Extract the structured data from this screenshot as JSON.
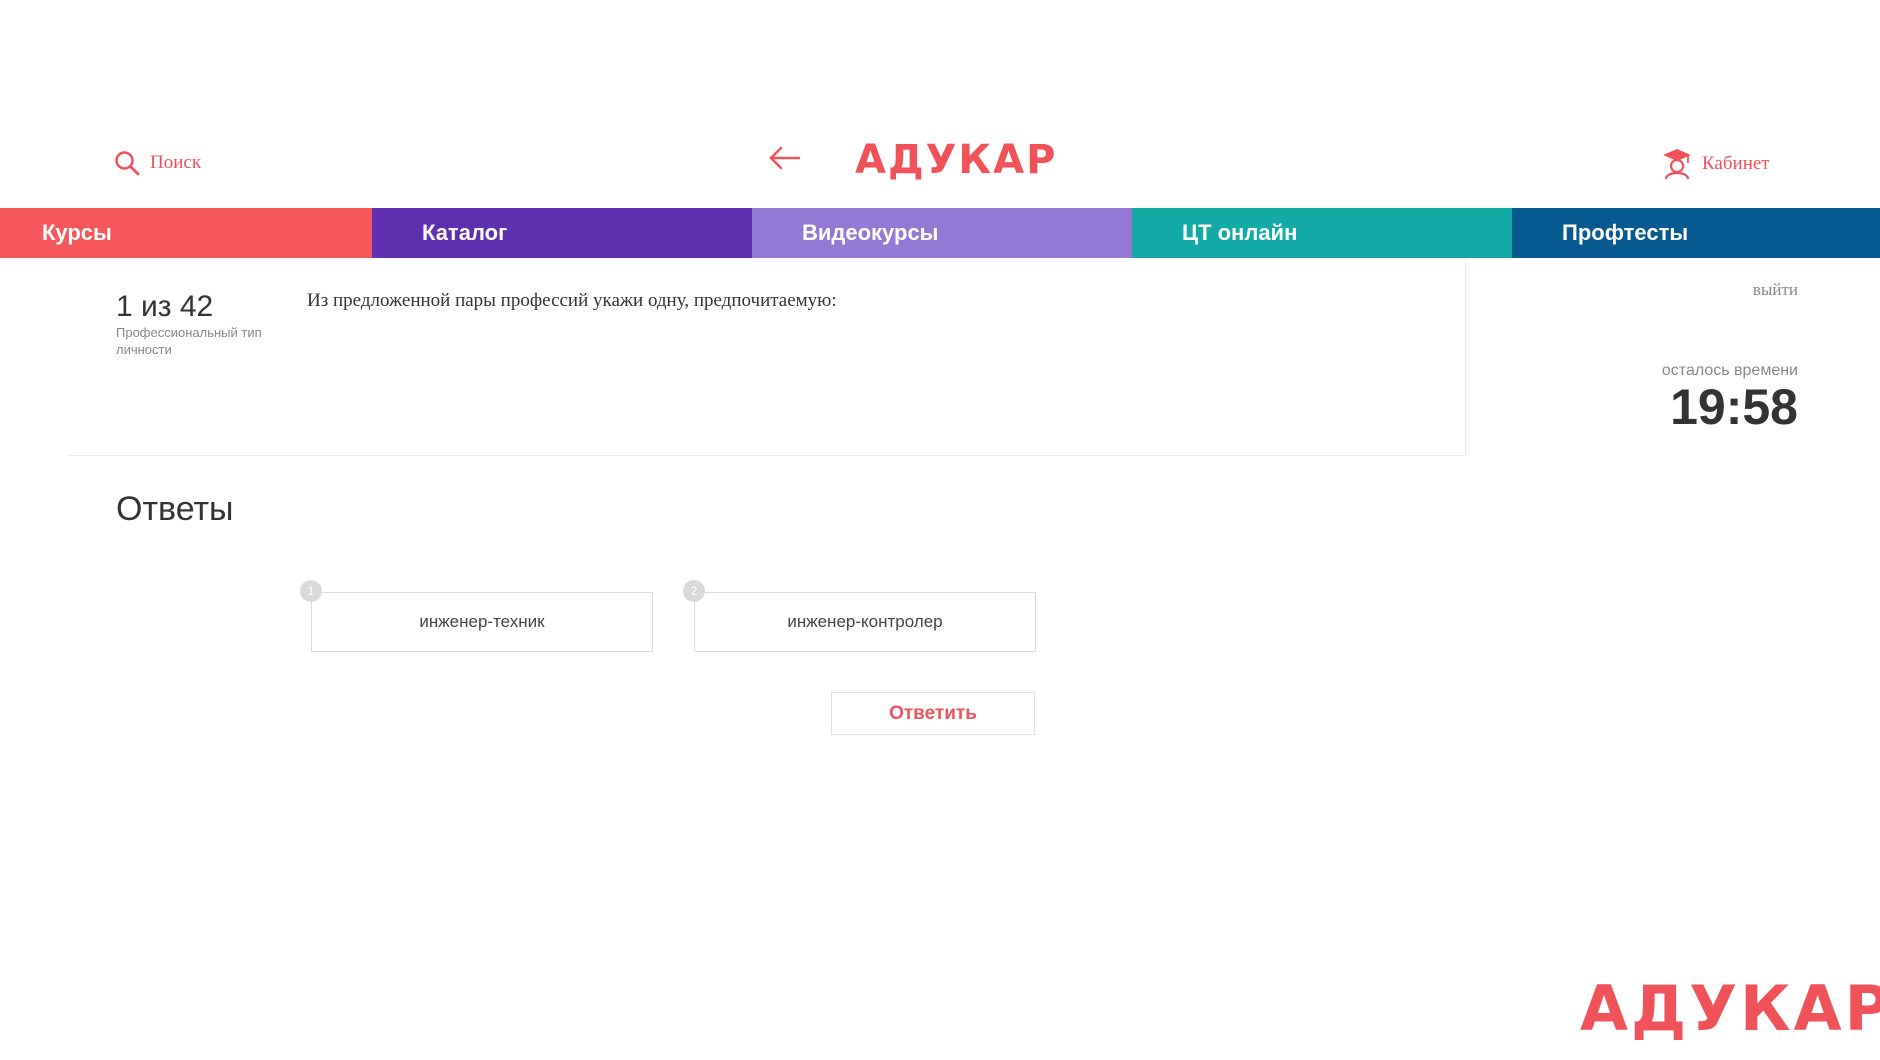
{
  "header": {
    "search_label": "Поиск",
    "logo": "АДУКАР",
    "cabinet_label": "Кабинет",
    "accent_color": "#f0525a"
  },
  "nav": {
    "items": [
      {
        "label": "Курсы",
        "color": "#f5575a"
      },
      {
        "label": "Каталог",
        "color": "#5e2fae"
      },
      {
        "label": "Видеокурсы",
        "color": "#9378d4"
      },
      {
        "label": "ЦТ онлайн",
        "color": "#12aaa5"
      },
      {
        "label": "Профтесты",
        "color": "#075a8f"
      }
    ]
  },
  "question": {
    "counter": "1 из 42",
    "test_name": "Профессиональный тип личности",
    "text": "Из предложенной пары профессий укажи одну, предпочитаемую:"
  },
  "sidebar": {
    "exit_label": "выйти",
    "timer_label": "осталось времени",
    "timer_value": "19:58"
  },
  "answers": {
    "title": "Ответы",
    "options": [
      {
        "number": "1",
        "label": "инженер-техник"
      },
      {
        "number": "2",
        "label": "инженер-контролер"
      }
    ],
    "submit_label": "Ответить"
  },
  "watermark": {
    "logo": "АДУКАР"
  },
  "icons": [
    "search-icon",
    "arrow-left-icon",
    "graduate-icon"
  ]
}
